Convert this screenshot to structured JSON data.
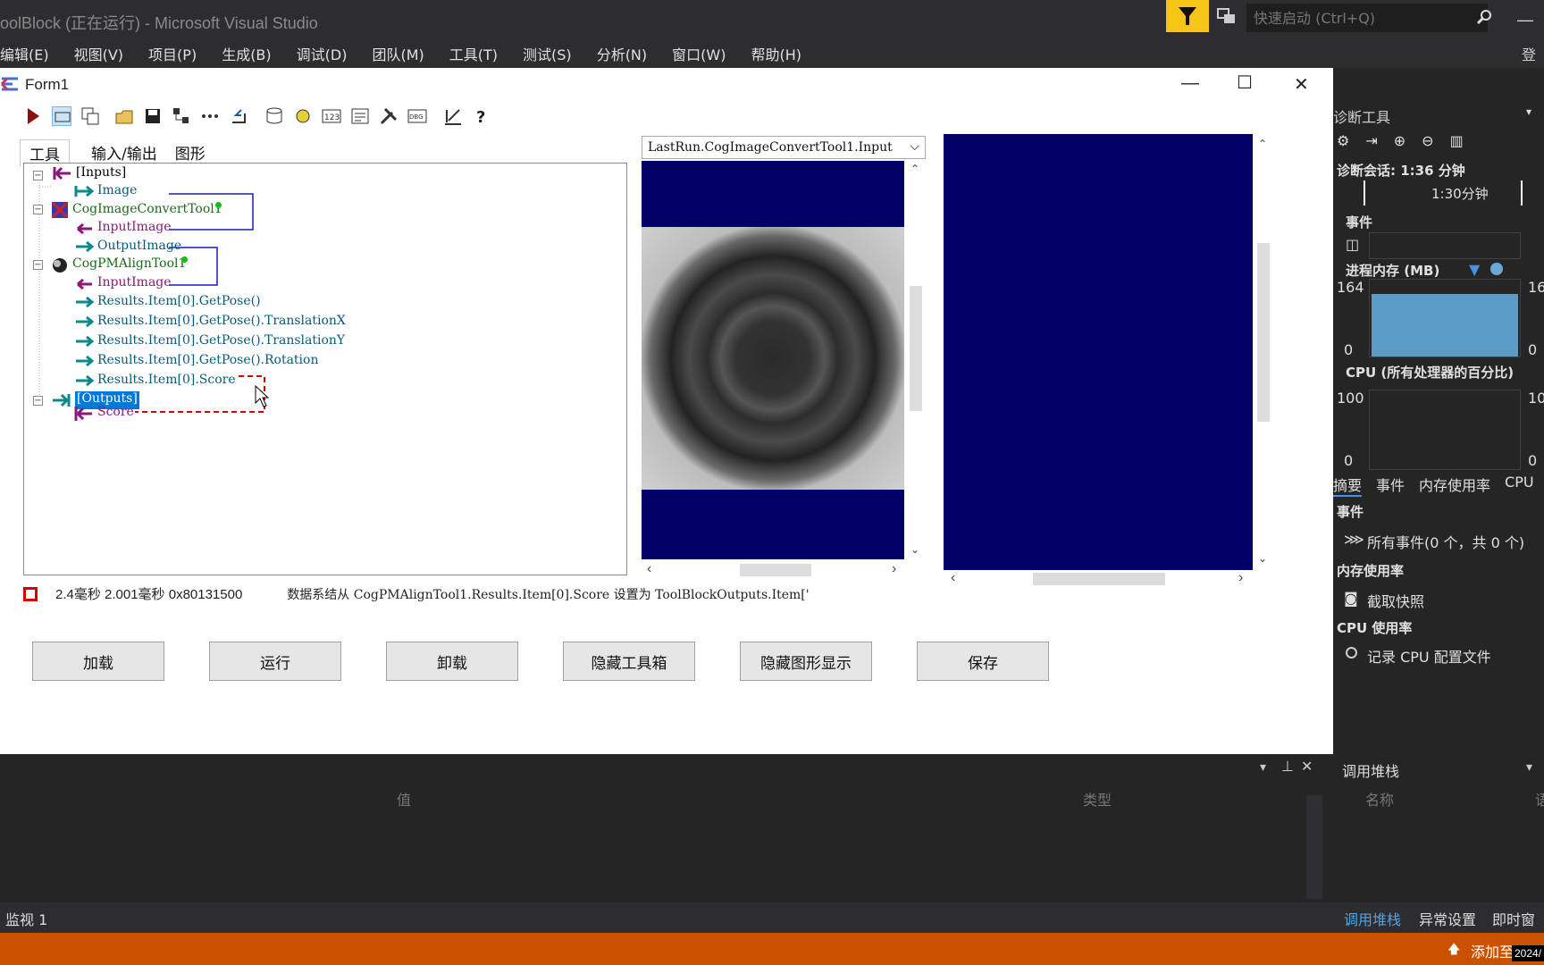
{
  "vs": {
    "title": "oolBlock (正在运行) - Microsoft Visual Studio",
    "quick_launch_placeholder": "快速启动 (Ctrl+Q)",
    "login": "登录",
    "menu": [
      "编辑(E)",
      "视图(V)",
      "项目(P)",
      "生成(B)",
      "调试(D)",
      "团队(M)",
      "工具(T)",
      "测试(S)",
      "分析(N)",
      "窗口(W)",
      "帮助(H)"
    ]
  },
  "form": {
    "title": "Form1",
    "tabs": [
      "工具",
      "输入/输出",
      "图形"
    ],
    "tree": {
      "inputs": "[Inputs]",
      "image": "Image",
      "convert_tool": "CogImageConvertTool1",
      "convert_input": "InputImage",
      "convert_output": "OutputImage",
      "pm_tool": "CogPMAlignTool1",
      "pm_input": "InputImage",
      "results": [
        "Results.Item[0].GetPose()",
        "Results.Item[0].GetPose().TranslationX",
        "Results.Item[0].GetPose().TranslationY",
        "Results.Item[0].GetPose().Rotation",
        "Results.Item[0].Score"
      ],
      "outputs": "[Outputs]",
      "score": "Score"
    },
    "image_select": "LastRun.CogImageConvertTool1.Input",
    "status_times": "2.4毫秒 2.001毫秒 0x80131500",
    "status_message": "数据系结从 CogPMAlignTool1.Results.Item[0].Score 设置为 ToolBlockOutputs.Item['",
    "buttons": [
      "加载",
      "运行",
      "卸载",
      "隐藏工具箱",
      "隐藏图形显示",
      "保存"
    ]
  },
  "diag": {
    "title": "诊断工具",
    "session": "诊断会话: 1:36 分钟",
    "timeline": "1:30分钟",
    "events_header": "事件",
    "memory_header": "进程内存 (MB)",
    "mem_max": "164",
    "mem_min": "0",
    "mem_max_r": "16",
    "mem_min_r": "0",
    "cpu_header": "CPU (所有处理器的百分比)",
    "cpu_max": "100",
    "cpu_min": "0",
    "cpu_max_r": "10",
    "cpu_min_r": "0",
    "tabs": [
      "摘要",
      "事件",
      "内存使用率",
      "CPU"
    ],
    "events_title": "事件",
    "all_events": "所有事件(0 个，共 0 个)",
    "mem_usage": "内存使用率",
    "snapshot": "截取快照",
    "cpu_usage": "CPU 使用率",
    "record_cpu": "记录 CPU 配置文件"
  },
  "watch": {
    "value_col": "值",
    "type_col": "类型",
    "tab": "监视 1"
  },
  "callstack": {
    "title": "调用堆栈",
    "name_col": "名称",
    "lang_col": "语",
    "tabs": [
      "调用堆栈",
      "异常设置",
      "即时窗"
    ]
  },
  "statusbar": {
    "add_source": "添加至",
    "year": "2024/"
  },
  "colors": {
    "vs_bg": "#2d2d30",
    "accent_orange": "#ca5100",
    "image_bg": "#000066",
    "selection": "#0078d7"
  }
}
